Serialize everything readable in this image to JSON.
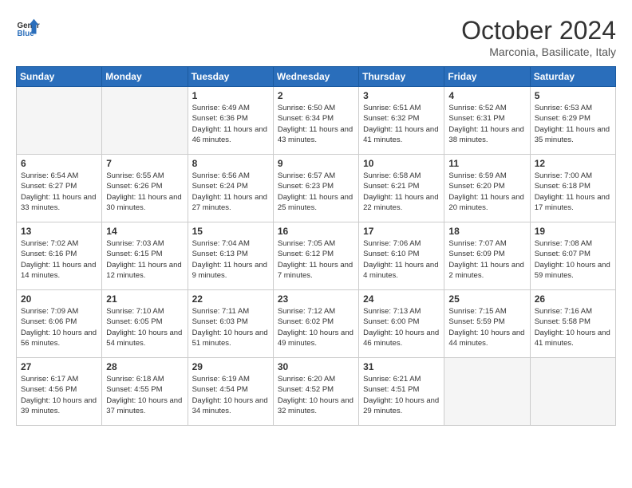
{
  "header": {
    "logo_general": "General",
    "logo_blue": "Blue",
    "month": "October 2024",
    "location": "Marconia, Basilicate, Italy"
  },
  "days_of_week": [
    "Sunday",
    "Monday",
    "Tuesday",
    "Wednesday",
    "Thursday",
    "Friday",
    "Saturday"
  ],
  "weeks": [
    [
      {
        "day": null
      },
      {
        "day": null
      },
      {
        "day": "1",
        "sunrise": "6:49 AM",
        "sunset": "6:36 PM",
        "daylight": "11 hours and 46 minutes."
      },
      {
        "day": "2",
        "sunrise": "6:50 AM",
        "sunset": "6:34 PM",
        "daylight": "11 hours and 43 minutes."
      },
      {
        "day": "3",
        "sunrise": "6:51 AM",
        "sunset": "6:32 PM",
        "daylight": "11 hours and 41 minutes."
      },
      {
        "day": "4",
        "sunrise": "6:52 AM",
        "sunset": "6:31 PM",
        "daylight": "11 hours and 38 minutes."
      },
      {
        "day": "5",
        "sunrise": "6:53 AM",
        "sunset": "6:29 PM",
        "daylight": "11 hours and 35 minutes."
      }
    ],
    [
      {
        "day": "6",
        "sunrise": "6:54 AM",
        "sunset": "6:27 PM",
        "daylight": "11 hours and 33 minutes."
      },
      {
        "day": "7",
        "sunrise": "6:55 AM",
        "sunset": "6:26 PM",
        "daylight": "11 hours and 30 minutes."
      },
      {
        "day": "8",
        "sunrise": "6:56 AM",
        "sunset": "6:24 PM",
        "daylight": "11 hours and 27 minutes."
      },
      {
        "day": "9",
        "sunrise": "6:57 AM",
        "sunset": "6:23 PM",
        "daylight": "11 hours and 25 minutes."
      },
      {
        "day": "10",
        "sunrise": "6:58 AM",
        "sunset": "6:21 PM",
        "daylight": "11 hours and 22 minutes."
      },
      {
        "day": "11",
        "sunrise": "6:59 AM",
        "sunset": "6:20 PM",
        "daylight": "11 hours and 20 minutes."
      },
      {
        "day": "12",
        "sunrise": "7:00 AM",
        "sunset": "6:18 PM",
        "daylight": "11 hours and 17 minutes."
      }
    ],
    [
      {
        "day": "13",
        "sunrise": "7:02 AM",
        "sunset": "6:16 PM",
        "daylight": "11 hours and 14 minutes."
      },
      {
        "day": "14",
        "sunrise": "7:03 AM",
        "sunset": "6:15 PM",
        "daylight": "11 hours and 12 minutes."
      },
      {
        "day": "15",
        "sunrise": "7:04 AM",
        "sunset": "6:13 PM",
        "daylight": "11 hours and 9 minutes."
      },
      {
        "day": "16",
        "sunrise": "7:05 AM",
        "sunset": "6:12 PM",
        "daylight": "11 hours and 7 minutes."
      },
      {
        "day": "17",
        "sunrise": "7:06 AM",
        "sunset": "6:10 PM",
        "daylight": "11 hours and 4 minutes."
      },
      {
        "day": "18",
        "sunrise": "7:07 AM",
        "sunset": "6:09 PM",
        "daylight": "11 hours and 2 minutes."
      },
      {
        "day": "19",
        "sunrise": "7:08 AM",
        "sunset": "6:07 PM",
        "daylight": "10 hours and 59 minutes."
      }
    ],
    [
      {
        "day": "20",
        "sunrise": "7:09 AM",
        "sunset": "6:06 PM",
        "daylight": "10 hours and 56 minutes."
      },
      {
        "day": "21",
        "sunrise": "7:10 AM",
        "sunset": "6:05 PM",
        "daylight": "10 hours and 54 minutes."
      },
      {
        "day": "22",
        "sunrise": "7:11 AM",
        "sunset": "6:03 PM",
        "daylight": "10 hours and 51 minutes."
      },
      {
        "day": "23",
        "sunrise": "7:12 AM",
        "sunset": "6:02 PM",
        "daylight": "10 hours and 49 minutes."
      },
      {
        "day": "24",
        "sunrise": "7:13 AM",
        "sunset": "6:00 PM",
        "daylight": "10 hours and 46 minutes."
      },
      {
        "day": "25",
        "sunrise": "7:15 AM",
        "sunset": "5:59 PM",
        "daylight": "10 hours and 44 minutes."
      },
      {
        "day": "26",
        "sunrise": "7:16 AM",
        "sunset": "5:58 PM",
        "daylight": "10 hours and 41 minutes."
      }
    ],
    [
      {
        "day": "27",
        "sunrise": "6:17 AM",
        "sunset": "4:56 PM",
        "daylight": "10 hours and 39 minutes."
      },
      {
        "day": "28",
        "sunrise": "6:18 AM",
        "sunset": "4:55 PM",
        "daylight": "10 hours and 37 minutes."
      },
      {
        "day": "29",
        "sunrise": "6:19 AM",
        "sunset": "4:54 PM",
        "daylight": "10 hours and 34 minutes."
      },
      {
        "day": "30",
        "sunrise": "6:20 AM",
        "sunset": "4:52 PM",
        "daylight": "10 hours and 32 minutes."
      },
      {
        "day": "31",
        "sunrise": "6:21 AM",
        "sunset": "4:51 PM",
        "daylight": "10 hours and 29 minutes."
      },
      {
        "day": null
      },
      {
        "day": null
      }
    ]
  ]
}
